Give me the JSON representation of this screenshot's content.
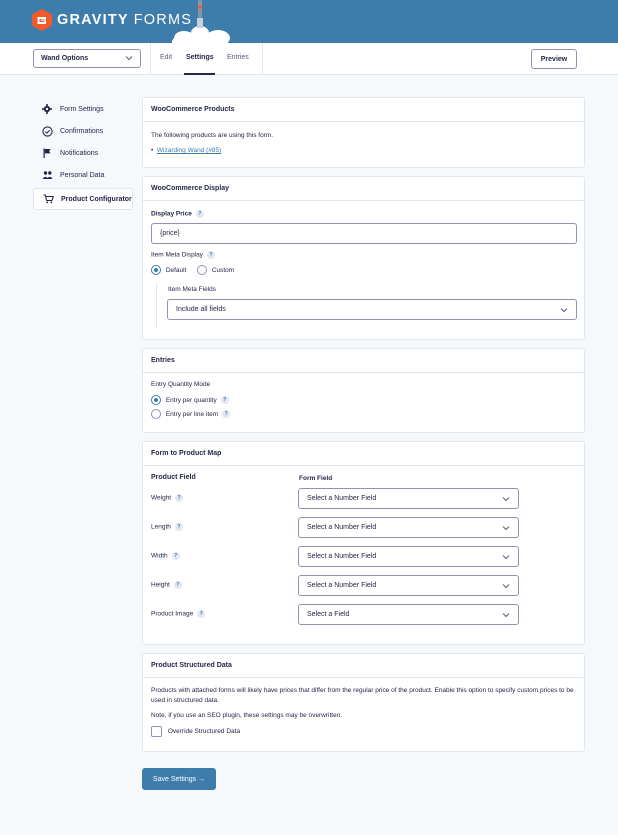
{
  "header": {
    "brand_bold": "GRAVITY",
    "brand_light": "FORMS"
  },
  "toolbar": {
    "form_select": "Wand Options",
    "tabs": [
      "Edit",
      "Settings",
      "Entries"
    ],
    "active_tab": "Settings",
    "preview_label": "Preview"
  },
  "sidebar": {
    "items": [
      {
        "label": "Form Settings",
        "icon": "gear-icon"
      },
      {
        "label": "Confirmations",
        "icon": "check-circle-icon"
      },
      {
        "label": "Notifications",
        "icon": "flag-icon"
      },
      {
        "label": "Personal Data",
        "icon": "people-icon"
      },
      {
        "label": "Product Configurator",
        "icon": "cart-icon",
        "active": true
      }
    ]
  },
  "woo_products": {
    "title": "WooCommerce Products",
    "intro": "The following products are using this form.",
    "product_link": "Wizarding Wand (#85)"
  },
  "woo_display": {
    "title": "WooCommerce Display",
    "display_price_label": "Display Price",
    "display_price_value": "{price}",
    "item_meta_label": "Item Meta Display",
    "option_default": "Default",
    "option_custom": "Custom",
    "selected": "Default",
    "meta_fields_label": "Item Meta Fields",
    "meta_fields_value": "Include all fields"
  },
  "entries": {
    "title": "Entries",
    "mode_label": "Entry Quantity Mode",
    "option_per_quantity": "Entry per quantity",
    "option_per_line": "Entry per line item",
    "selected": "Entry per quantity"
  },
  "form_map": {
    "title": "Form to Product Map",
    "col_product": "Product Field",
    "col_form": "Form Field",
    "rows": [
      {
        "field": "Weight",
        "value": "Select a Number Field"
      },
      {
        "field": "Length",
        "value": "Select a Number Field"
      },
      {
        "field": "Width",
        "value": "Select a Number Field"
      },
      {
        "field": "Height",
        "value": "Select a Number Field"
      },
      {
        "field": "Product Image",
        "value": "Select a Field"
      }
    ]
  },
  "structured": {
    "title": "Product Structured Data",
    "desc": "Products with attached forms will likely have prices that differ from the regular price of the product. Enable this option to specify custom prices to be used in structured data.",
    "note": "Note, if you use an SEO plugin, these settings may be overwritten.",
    "checkbox_label": "Override Structured Data",
    "checked": false
  },
  "save_label": "Save Settings →",
  "colors": {
    "brand": "#3e7dab",
    "text": "#242748",
    "page_bg": "#f6f9fc"
  }
}
